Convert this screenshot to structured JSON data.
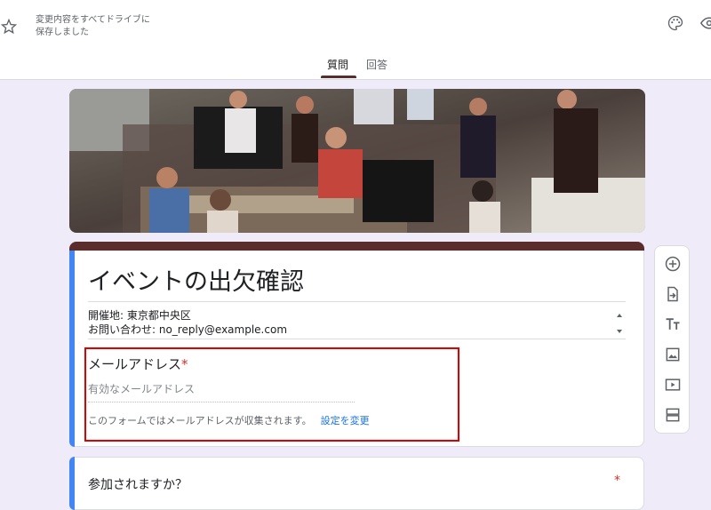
{
  "header": {
    "saved_status": "変更内容をすべてドライブに\n保存しました",
    "icons": [
      "star-icon",
      "palette-icon",
      "eye-icon"
    ]
  },
  "tabs": [
    {
      "label": "質問",
      "active": true
    },
    {
      "label": "回答",
      "active": false
    }
  ],
  "form": {
    "title": "イベントの出欠確認",
    "description_line1": "開催地: 東京都中央区",
    "description_line2": "お問い合わせ:  no_reply@example.com",
    "email_label": "メールアドレス",
    "required_mark": "*",
    "email_placeholder": "有効なメールアドレス",
    "collect_note": "このフォームではメールアドレスが収集されます。",
    "change_settings": "設定を変更"
  },
  "question": {
    "text": "参加されますか？",
    "required_mark": "*"
  },
  "toolbar": [
    "add-question-icon",
    "import-questions-icon",
    "add-title-icon",
    "add-image-icon",
    "add-video-icon",
    "add-section-icon"
  ],
  "colors": {
    "theme": "#5b2c2c",
    "accent": "#4285f4",
    "link": "#1a73e8",
    "required": "#d93025",
    "highlight": "#e00000"
  }
}
